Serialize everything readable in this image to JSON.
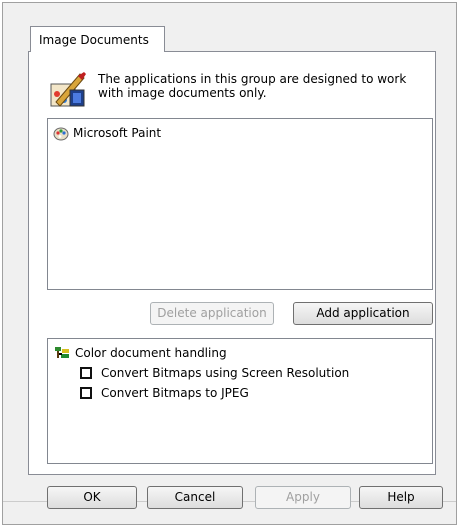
{
  "tab": {
    "label": "Image Documents"
  },
  "info": {
    "description": "The applications in this group are designed to work with image documents only.",
    "icon": "paint-palette-icon"
  },
  "applications": [
    {
      "label": "Microsoft Paint",
      "icon": "paint-app-icon"
    }
  ],
  "list_buttons": {
    "delete": "Delete application",
    "add": "Add application"
  },
  "handling": {
    "title": "Color document handling",
    "icon": "color-tree-icon",
    "options": [
      {
        "label": "Convert Bitmaps using Screen Resolution",
        "checked": false
      },
      {
        "label": "Convert Bitmaps to JPEG",
        "checked": false
      }
    ]
  },
  "dialog_buttons": {
    "ok": "OK",
    "cancel": "Cancel",
    "apply": "Apply",
    "help": "Help"
  },
  "colors": {
    "panel_bg": "#ffffff",
    "window_bg": "#f0f0f0",
    "border": "#898c95"
  }
}
